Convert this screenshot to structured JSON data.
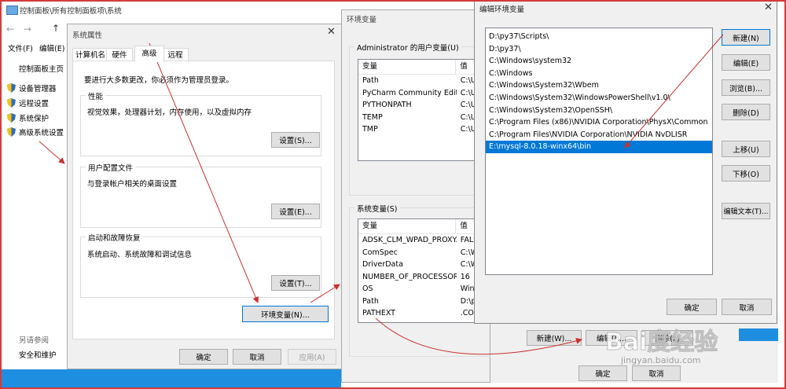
{
  "explorer": {
    "title": "控制面板\\所有控制面板项\\系统",
    "menu": [
      "文件(F)",
      "编辑(E)"
    ],
    "side_home": "控制面板主页",
    "side_links": [
      "设备管理器",
      "远程设置",
      "系统保护",
      "高级系统设置"
    ],
    "see_also": "另请参阅",
    "security": "安全和维护"
  },
  "sysprops": {
    "title": "系统属性",
    "tabs": [
      "计算机名",
      "硬件",
      "高级",
      "远程"
    ],
    "admin_note": "要进行大多数更改，你必须作为管理员登录。",
    "perf_title": "性能",
    "perf_desc": "视觉效果，处理器计划，内存使用，以及虚拟内存",
    "perf_btn": "设置(S)...",
    "profile_title": "用户配置文件",
    "profile_desc": "与登录帐户相关的桌面设置",
    "profile_btn": "设置(E)...",
    "startup_title": "启动和故障恢复",
    "startup_desc": "系统启动、系统故障和调试信息",
    "startup_btn": "设置(T)...",
    "env_btn": "环境变量(N)...",
    "ok": "确定",
    "cancel": "取消",
    "apply": "应用(A)"
  },
  "envvars": {
    "title": "环境变量",
    "user_group": "Administrator 的用户变量(U)",
    "col_var": "变量",
    "col_val": "值",
    "user_vars": [
      {
        "name": "Path",
        "value": "C:\\U"
      },
      {
        "name": "PyCharm Community Editi...",
        "value": "C:\\U"
      },
      {
        "name": "PYTHONPATH",
        "value": "C:\\U"
      },
      {
        "name": "TEMP",
        "value": "C:\\U"
      },
      {
        "name": "TMP",
        "value": "C:\\U"
      }
    ],
    "sys_group": "系统变量(S)",
    "sys_vars": [
      {
        "name": "ADSK_CLM_WPAD_PROXY...",
        "value": "FALS"
      },
      {
        "name": "ComSpec",
        "value": "C:\\W"
      },
      {
        "name": "DriverData",
        "value": "C:\\W"
      },
      {
        "name": "NUMBER_OF_PROCESSORS",
        "value": "16"
      },
      {
        "name": "OS",
        "value": "Win"
      },
      {
        "name": "Path",
        "value": "D:\\p"
      },
      {
        "name": "PATHEXT",
        "value": ".CO"
      }
    ],
    "new_btn": "新建(W)...",
    "edit_btn": "编辑(I)...",
    "delete_btn": "删除(L)",
    "ok": "确定",
    "cancel": "取消"
  },
  "editenv": {
    "title": "编辑环境变量",
    "paths": [
      "D:\\py37\\Scripts\\",
      "D:\\py37\\",
      "C:\\Windows\\system32",
      "C:\\Windows",
      "C:\\Windows\\System32\\Wbem",
      "C:\\Windows\\System32\\WindowsPowerShell\\v1.0\\",
      "C:\\Windows\\System32\\OpenSSH\\",
      "C:\\Program Files (x86)\\NVIDIA Corporation\\PhysX\\Common",
      "C:\\Program Files\\NVIDIA Corporation\\NVIDIA NvDLISR",
      "E:\\mysql-8.0.18-winx64\\bin"
    ],
    "selected_index": 9,
    "new": "新建(N)",
    "edit": "编辑(E)",
    "browse": "浏览(B)...",
    "delete": "删除(D)",
    "up": "上移(U)",
    "down": "下移(O)",
    "edit_text": "编辑文本(T)...",
    "ok": "确定",
    "cancel": "取消"
  },
  "watermark": {
    "brand": "Bai度经验",
    "url": "jingyan.baidu.com"
  },
  "colors": {
    "border_red": "#d23c3c",
    "arrow_red": "#c83232",
    "selection": "#0078d7",
    "taskbar": "#1e8ee0"
  }
}
